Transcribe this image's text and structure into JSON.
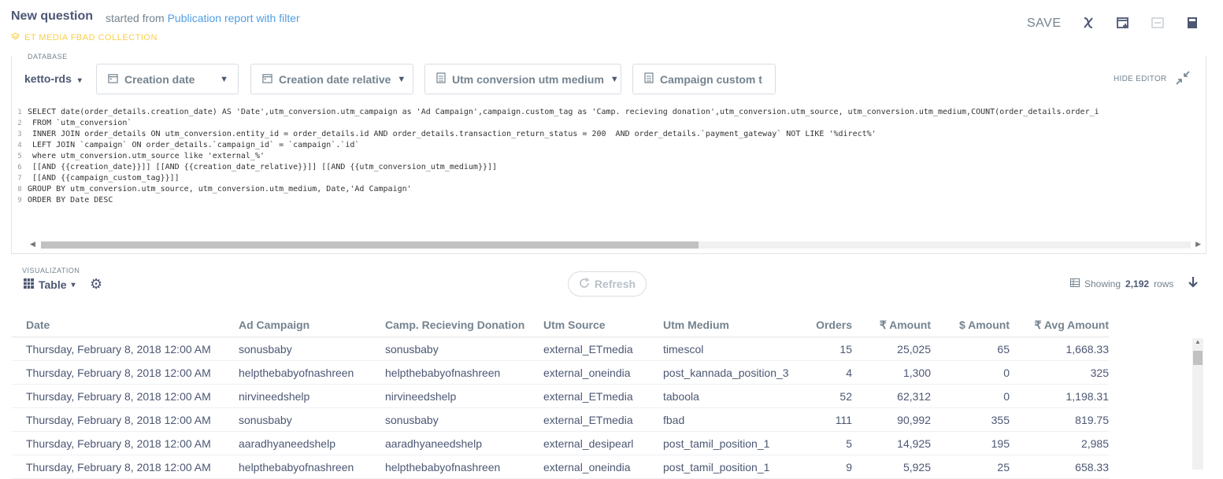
{
  "header": {
    "title": "New question",
    "started_prefix": "started from",
    "source_link": "Publication report with filter",
    "collection": "ET MEDIA FBAD COLLECTION",
    "save_label": "SAVE"
  },
  "editor": {
    "database_label": "DATABASE",
    "database_value": "ketto-rds",
    "filters": [
      {
        "label": "Creation date",
        "icon": "calendar-icon"
      },
      {
        "label": "Creation date relative",
        "icon": "calendar-icon"
      },
      {
        "label": "Utm conversion utm medium",
        "icon": "document-icon"
      },
      {
        "label": "Campaign custom t",
        "icon": "document-icon"
      }
    ],
    "hide_editor_label": "HIDE EDITOR",
    "lines": [
      {
        "n": "1",
        "text": "SELECT date(order_details.creation_date) AS 'Date',utm_conversion.utm_campaign as 'Ad Campaign',campaign.custom_tag as 'Camp. recieving donation',utm_conversion.utm_source, utm_conversion.utm_medium,COUNT(order_details.order_i"
      },
      {
        "n": "2",
        "text": " FROM `utm_conversion`"
      },
      {
        "n": "3",
        "text": " INNER JOIN order_details ON utm_conversion.entity_id = order_details.id AND order_details.transaction_return_status = 200  AND order_details.`payment_gateway` NOT LIKE '%direct%'"
      },
      {
        "n": "4",
        "text": " LEFT JOIN `campaign` ON order_details.`campaign_id` = `campaign`.`id`"
      },
      {
        "n": "5",
        "text": " where utm_conversion.utm_source like 'external_%'"
      },
      {
        "n": "6",
        "text": " [[AND {{creation_date}}]] [[AND {{creation_date_relative}}]] [[AND {{utm_conversion_utm_medium}}]]"
      },
      {
        "n": "7",
        "text": " [[AND {{campaign_custom_tag}}]]"
      },
      {
        "n": "8",
        "text": "GROUP BY utm_conversion.utm_source, utm_conversion.utm_medium, Date,'Ad Campaign'"
      },
      {
        "n": "9",
        "text": "ORDER BY Date DESC"
      }
    ]
  },
  "visualization": {
    "label": "VISUALIZATION",
    "type": "Table",
    "refresh_label": "Refresh",
    "showing_prefix": "Showing",
    "row_count": "2,192",
    "showing_suffix": "rows"
  },
  "table": {
    "columns": [
      "Date",
      "Ad Campaign",
      "Camp. Recieving Donation",
      "Utm Source",
      "Utm Medium",
      "Orders",
      "₹ Amount",
      "$ Amount",
      "₹ Avg Amount"
    ],
    "rows": [
      [
        "Thursday, February 8, 2018 12:00 AM",
        "sonusbaby",
        "sonusbaby",
        "external_ETmedia",
        "timescol",
        "15",
        "25,025",
        "65",
        "1,668.33"
      ],
      [
        "Thursday, February 8, 2018 12:00 AM",
        "helpthebabyofnashreen",
        "helpthebabyofnashreen",
        "external_oneindia",
        "post_kannada_position_3",
        "4",
        "1,300",
        "0",
        "325"
      ],
      [
        "Thursday, February 8, 2018 12:00 AM",
        "nirvineedshelp",
        "nirvineedshelp",
        "external_ETmedia",
        "taboola",
        "52",
        "62,312",
        "0",
        "1,198.31"
      ],
      [
        "Thursday, February 8, 2018 12:00 AM",
        "sonusbaby",
        "sonusbaby",
        "external_ETmedia",
        "fbad",
        "111",
        "90,992",
        "355",
        "819.75"
      ],
      [
        "Thursday, February 8, 2018 12:00 AM",
        "aaradhyaneedshelp",
        "aaradhyaneedshelp",
        "external_desipearl",
        "post_tamil_position_1",
        "5",
        "14,925",
        "195",
        "2,985"
      ],
      [
        "Thursday, February 8, 2018 12:00 AM",
        "helpthebabyofnashreen",
        "helpthebabyofnashreen",
        "external_oneindia",
        "post_tamil_position_1",
        "9",
        "5,925",
        "25",
        "658.33"
      ]
    ]
  }
}
